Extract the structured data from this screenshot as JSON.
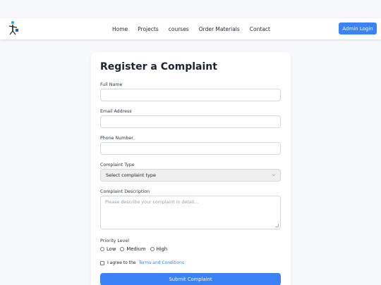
{
  "nav": {
    "links": [
      "Home",
      "Projects",
      "courses",
      "Order Materials",
      "Contact"
    ],
    "admin_button": "Admin Login"
  },
  "form": {
    "title": "Register a Complaint",
    "full_name_label": "Full Name",
    "email_label": "Email Address",
    "phone_label": "Phone Number",
    "complaint_type_label": "Complaint Type",
    "complaint_type_selected": "Select complaint type",
    "description_label": "Complaint Description",
    "description_placeholder": "Please describe your complaint in detail...",
    "priority_label": "Priority Level",
    "priority_options": [
      "Low",
      "Medium",
      "High"
    ],
    "agree_text": "I agree to the",
    "terms_link": "Terms and Conditions",
    "submit_button": "Submit Complaint"
  },
  "colors": {
    "accent": "#3b82f6",
    "background": "#f7f8fb",
    "card": "#ffffff"
  },
  "icons": {
    "logo": "person-figure-logo-icon",
    "select_chevron": "chevron-down-icon"
  }
}
